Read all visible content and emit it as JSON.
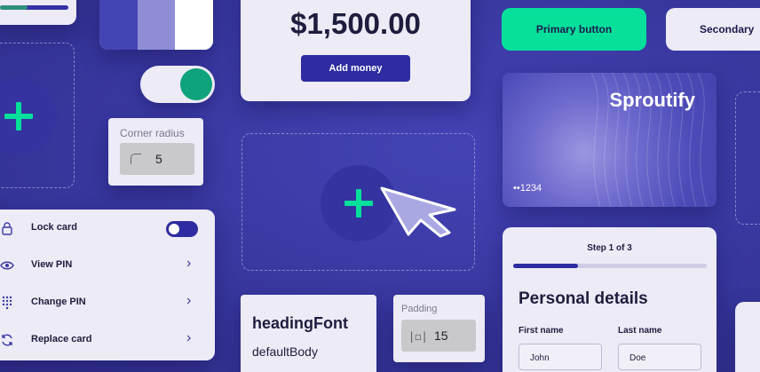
{
  "colors": {
    "background": "#3b3aa3",
    "accent_green": "#06e09b",
    "primary_dark": "#2e2ca0",
    "card": "#ecebf6",
    "toggle_green": "#0ea37a"
  },
  "top_progress": {
    "fraction": 0.4
  },
  "swatches": [
    "#4544b6",
    "#8f8dd6",
    "#ffffff"
  ],
  "corner_radius": {
    "label": "Corner radius",
    "value": "5",
    "icon": "corner-radius-icon"
  },
  "money": {
    "amount": "$1,500.00",
    "button_label": "Add money"
  },
  "buttons": {
    "primary_label": "Primary button",
    "secondary_label": "Secondary"
  },
  "credit_card": {
    "brand": "Sproutify",
    "number": "••1234"
  },
  "menu": {
    "items": [
      {
        "label": "Lock card",
        "icon": "lock-icon",
        "control": "toggle"
      },
      {
        "label": "View PIN",
        "icon": "eye-icon",
        "control": "chevron"
      },
      {
        "label": "Change PIN",
        "icon": "keypad-icon",
        "control": "chevron"
      },
      {
        "label": "Replace card",
        "icon": "refresh-icon",
        "control": "chevron"
      }
    ]
  },
  "fonts_card": {
    "heading": "headingFont",
    "body": "defaultBody"
  },
  "padding": {
    "label": "Padding",
    "value": "15",
    "icon_text": "|◻|"
  },
  "details": {
    "step_label": "Step 1 of 3",
    "step_fraction": 0.333,
    "title": "Personal details",
    "first_name_label": "First name",
    "first_name_value": "John",
    "last_name_label": "Last name",
    "last_name_value": "Doe"
  }
}
